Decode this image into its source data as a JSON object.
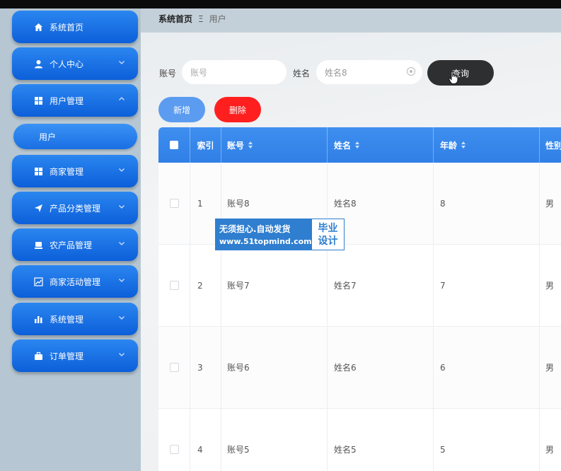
{
  "sidebar": {
    "items": [
      {
        "label": "系统首页",
        "icon": "home-icon"
      },
      {
        "label": "个人中心",
        "icon": "user-icon"
      },
      {
        "label": "用户管理",
        "icon": "grid-icon"
      },
      {
        "label": "商家管理",
        "icon": "grid-icon"
      },
      {
        "label": "产品分类管理",
        "icon": "send-icon"
      },
      {
        "label": "农产品管理",
        "icon": "box-icon"
      },
      {
        "label": "商家活动管理",
        "icon": "chart-line-icon"
      },
      {
        "label": "系统管理",
        "icon": "bar-chart-icon"
      },
      {
        "label": "订单管理",
        "icon": "briefcase-icon"
      }
    ],
    "subitem": {
      "label": "用户"
    }
  },
  "breadcrumb": {
    "home": "系统首页",
    "separator": "Ξ",
    "current": "用户"
  },
  "search": {
    "account_label": "账号",
    "account_placeholder": "账号",
    "name_label": "姓名",
    "name_value": "姓名8",
    "query_button": "查询"
  },
  "actions": {
    "add": "新增",
    "delete": "删除"
  },
  "table": {
    "headers": {
      "index": "索引",
      "account": "账号",
      "name": "姓名",
      "age": "年龄",
      "gender": "性别"
    },
    "rows": [
      {
        "index": "1",
        "account": "账号8",
        "name": "姓名8",
        "age": "8",
        "gender": "男"
      },
      {
        "index": "2",
        "account": "账号7",
        "name": "姓名7",
        "age": "7",
        "gender": "男"
      },
      {
        "index": "3",
        "account": "账号6",
        "name": "姓名6",
        "age": "6",
        "gender": "男"
      },
      {
        "index": "4",
        "account": "账号5",
        "name": "姓名5",
        "age": "5",
        "gender": "男"
      }
    ]
  },
  "watermark": {
    "line1": "无须担心.自动发货",
    "line2": "www.51topmind.com",
    "right1": "毕业",
    "right2": "设计"
  },
  "colors": {
    "primary": "#1a6fe3",
    "query": "#2e2f30",
    "delete": "#ff1f1f",
    "add": "#5b9cf0"
  }
}
